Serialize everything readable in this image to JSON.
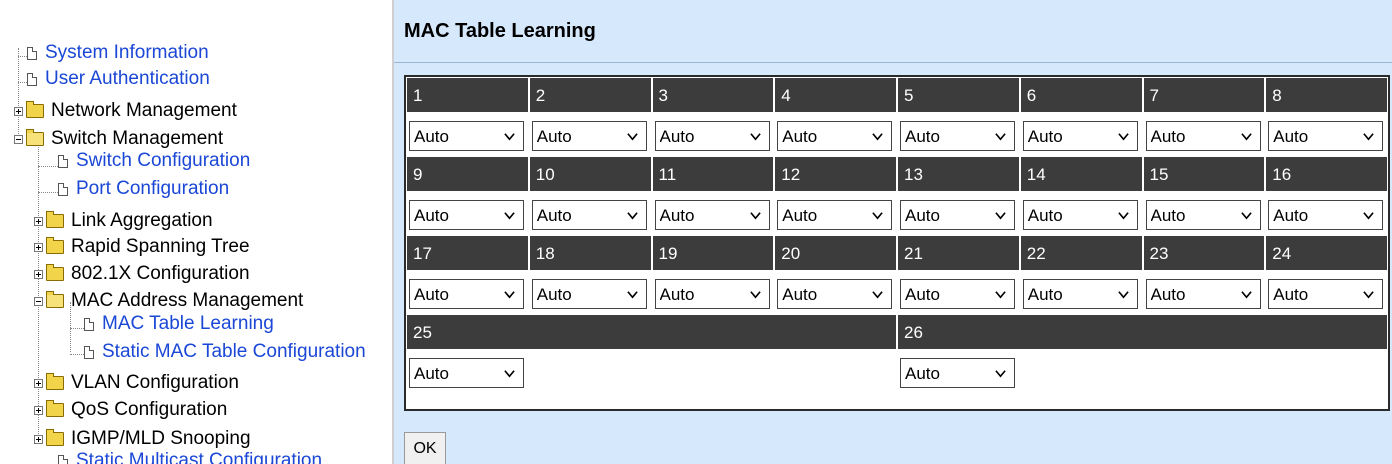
{
  "nav": {
    "items": [
      {
        "label": "System Information",
        "kind": "page"
      },
      {
        "label": "User Authentication",
        "kind": "page"
      },
      {
        "label": "Network Management",
        "kind": "folder-collapsed"
      },
      {
        "label": "Switch Management",
        "kind": "folder-expanded"
      },
      {
        "label": "Switch Configuration",
        "kind": "page"
      },
      {
        "label": "Port Configuration",
        "kind": "page"
      },
      {
        "label": "Link Aggregation",
        "kind": "folder-collapsed"
      },
      {
        "label": "Rapid Spanning Tree",
        "kind": "folder-collapsed"
      },
      {
        "label": "802.1X Configuration",
        "kind": "folder-collapsed"
      },
      {
        "label": "MAC Address Management",
        "kind": "folder-expanded"
      },
      {
        "label": "MAC Table Learning",
        "kind": "page"
      },
      {
        "label": "Static MAC Table Configuration",
        "kind": "page"
      },
      {
        "label": "VLAN Configuration",
        "kind": "folder-collapsed"
      },
      {
        "label": "QoS Configuration",
        "kind": "folder-collapsed"
      },
      {
        "label": "IGMP/MLD Snooping",
        "kind": "folder-collapsed"
      },
      {
        "label": "Static Multicast Configuration",
        "kind": "page"
      }
    ]
  },
  "page": {
    "title": "MAC Table Learning"
  },
  "ports": [
    {
      "label": "1",
      "value": "Auto"
    },
    {
      "label": "2",
      "value": "Auto"
    },
    {
      "label": "3",
      "value": "Auto"
    },
    {
      "label": "4",
      "value": "Auto"
    },
    {
      "label": "5",
      "value": "Auto"
    },
    {
      "label": "6",
      "value": "Auto"
    },
    {
      "label": "7",
      "value": "Auto"
    },
    {
      "label": "8",
      "value": "Auto"
    },
    {
      "label": "9",
      "value": "Auto"
    },
    {
      "label": "10",
      "value": "Auto"
    },
    {
      "label": "11",
      "value": "Auto"
    },
    {
      "label": "12",
      "value": "Auto"
    },
    {
      "label": "13",
      "value": "Auto"
    },
    {
      "label": "14",
      "value": "Auto"
    },
    {
      "label": "15",
      "value": "Auto"
    },
    {
      "label": "16",
      "value": "Auto"
    },
    {
      "label": "17",
      "value": "Auto"
    },
    {
      "label": "18",
      "value": "Auto"
    },
    {
      "label": "19",
      "value": "Auto"
    },
    {
      "label": "20",
      "value": "Auto"
    },
    {
      "label": "21",
      "value": "Auto"
    },
    {
      "label": "22",
      "value": "Auto"
    },
    {
      "label": "23",
      "value": "Auto"
    },
    {
      "label": "24",
      "value": "Auto"
    },
    {
      "label": "25",
      "value": "Auto"
    },
    {
      "label": "26",
      "value": "Auto"
    }
  ],
  "ok_button": {
    "label": "OK"
  },
  "colors": {
    "content_background": "#d6e8fb",
    "port_header_background": "#3c3c3c",
    "nav_link": "#1a47d6"
  }
}
